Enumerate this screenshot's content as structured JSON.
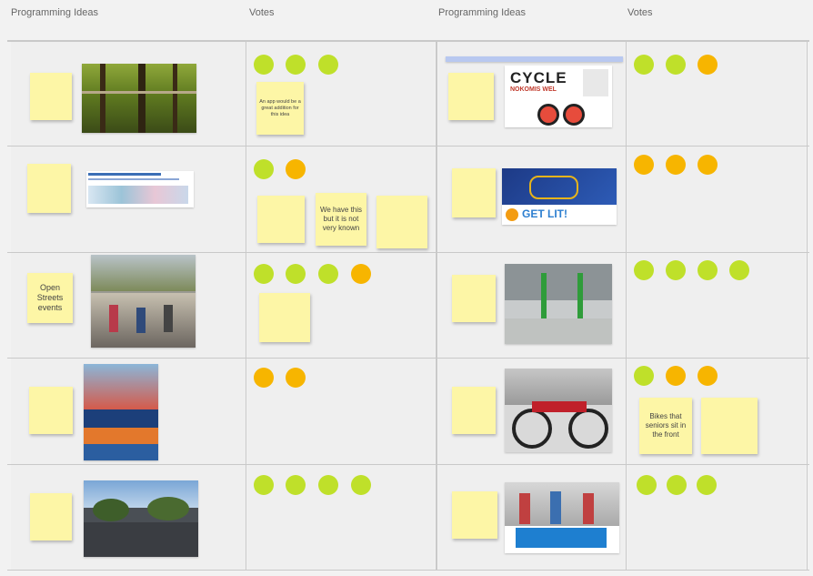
{
  "headers": {
    "col1": "Programming Ideas",
    "col2": "Votes",
    "col3": "Programming Ideas",
    "col4": "Votes"
  },
  "rows": [
    {
      "left_idea_note": "",
      "left_votes": [
        "green",
        "green",
        "green"
      ],
      "left_vote_notes": [
        "An app would be a great addition for this idea"
      ],
      "right_idea_note": "",
      "right_image_text": {
        "title": "CYCLE",
        "subtitle": "NOKOMIS WEL"
      },
      "right_votes": [
        "green",
        "green",
        "orange"
      ]
    },
    {
      "left_idea_note": "",
      "left_votes": [
        "green",
        "orange"
      ],
      "left_vote_notes": [
        "",
        "We have this but it is not very known",
        ""
      ],
      "right_idea_note": "",
      "right_image_text": {
        "title": "GET LIT!"
      },
      "right_votes": [
        "orange",
        "orange",
        "orange"
      ]
    },
    {
      "left_idea_note": "Open Streets events",
      "left_votes": [
        "green",
        "green",
        "green",
        "orange"
      ],
      "left_vote_notes": [
        ""
      ],
      "right_idea_note": "",
      "right_votes": [
        "green",
        "green",
        "green",
        "green"
      ]
    },
    {
      "left_idea_note": "",
      "left_votes": [
        "orange",
        "orange"
      ],
      "left_vote_notes": [],
      "right_idea_note": "",
      "right_votes": [
        "green",
        "orange",
        "orange"
      ],
      "right_vote_notes": [
        "Bikes that seniors sit in the front",
        ""
      ]
    },
    {
      "left_idea_note": "",
      "left_votes": [
        "green",
        "green",
        "green",
        "green"
      ],
      "left_vote_notes": [],
      "right_idea_note": "",
      "right_votes": [
        "green",
        "green",
        "green"
      ]
    }
  ],
  "colors": {
    "green": "#bfe02a",
    "orange": "#f7b500",
    "sticky": "#fdf6a6",
    "cell": "#efefef",
    "grid": "#c9c9c9"
  }
}
